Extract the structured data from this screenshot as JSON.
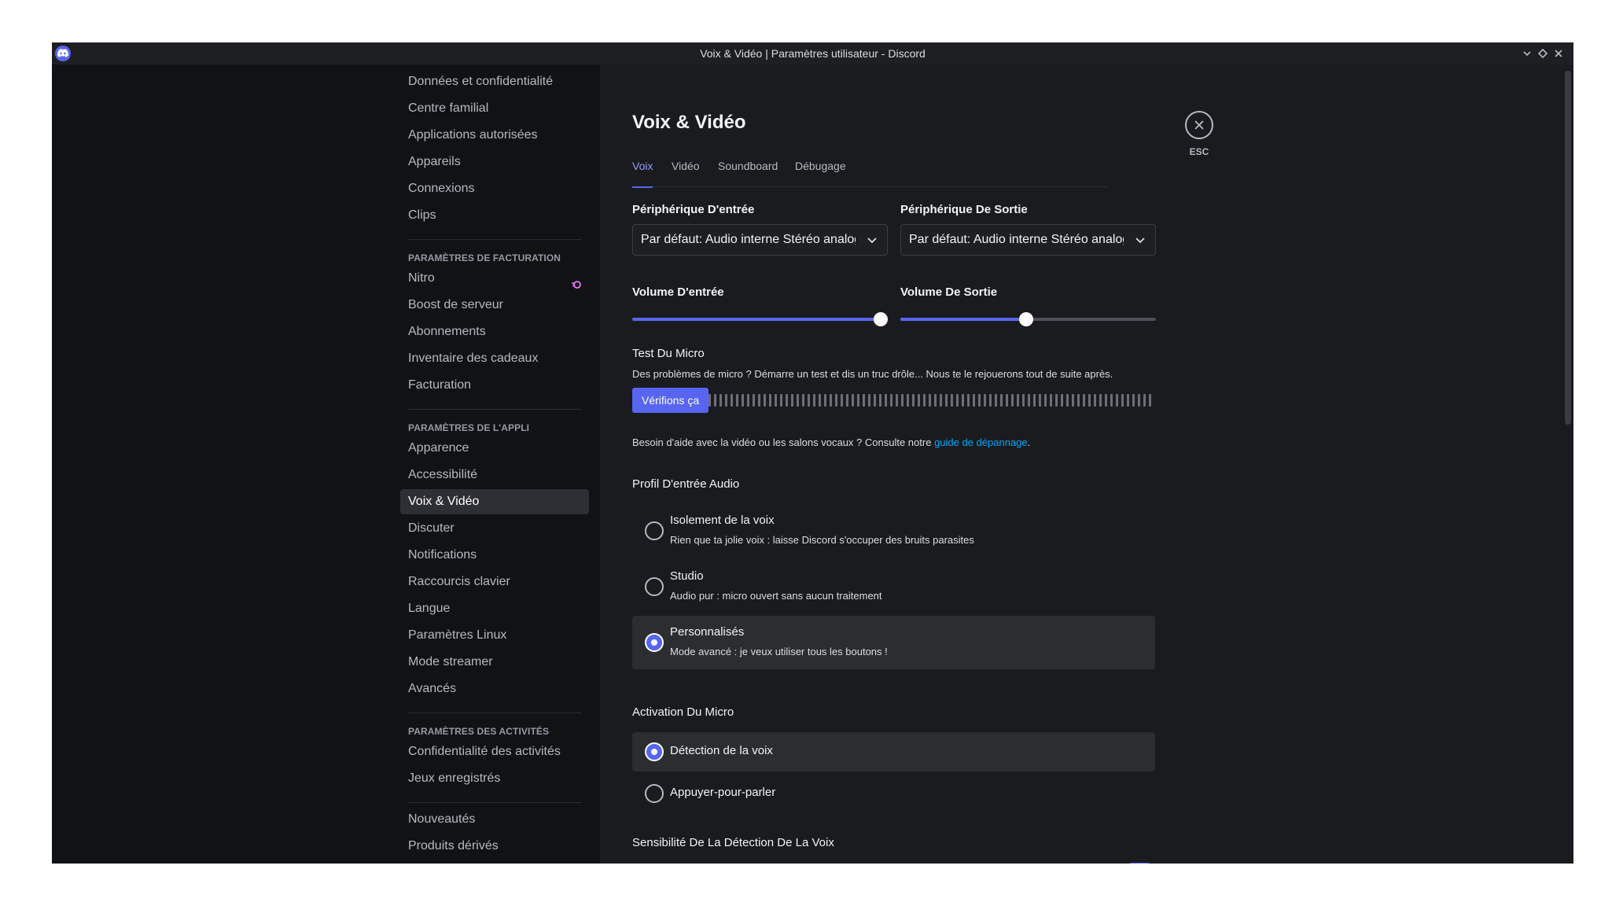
{
  "window": {
    "title": "Voix & Vidéo | Paramètres utilisateur - Discord"
  },
  "sidebar": {
    "items_top": [
      {
        "name": "sidebar-item-donnees-confidentialite",
        "label": "Données et confidentialité"
      },
      {
        "name": "sidebar-item-centre-familial",
        "label": "Centre familial"
      },
      {
        "name": "sidebar-item-applications-autorisees",
        "label": "Applications autorisées"
      },
      {
        "name": "sidebar-item-appareils",
        "label": "Appareils"
      },
      {
        "name": "sidebar-item-connexions",
        "label": "Connexions"
      },
      {
        "name": "sidebar-item-clips",
        "label": "Clips"
      }
    ],
    "billing_header": "PARAMÈTRES DE FACTURATION",
    "billing_items": [
      {
        "name": "sidebar-item-nitro",
        "label": "Nitro"
      },
      {
        "name": "sidebar-item-boost-serveur",
        "label": "Boost de serveur"
      },
      {
        "name": "sidebar-item-abonnements",
        "label": "Abonnements"
      },
      {
        "name": "sidebar-item-inventaire-cadeaux",
        "label": "Inventaire des cadeaux"
      },
      {
        "name": "sidebar-item-facturation",
        "label": "Facturation"
      }
    ],
    "app_header": "PARAMÈTRES DE L'APPLI",
    "app_items": [
      {
        "name": "sidebar-item-apparence",
        "label": "Apparence"
      },
      {
        "name": "sidebar-item-accessibilite",
        "label": "Accessibilité"
      },
      {
        "name": "sidebar-item-voix-video",
        "label": "Voix & Vidéo"
      },
      {
        "name": "sidebar-item-discuter",
        "label": "Discuter"
      },
      {
        "name": "sidebar-item-notifications",
        "label": "Notifications"
      },
      {
        "name": "sidebar-item-raccourcis-clavier",
        "label": "Raccourcis clavier"
      },
      {
        "name": "sidebar-item-langue",
        "label": "Langue"
      },
      {
        "name": "sidebar-item-parametres-linux",
        "label": "Paramètres Linux"
      },
      {
        "name": "sidebar-item-mode-streamer",
        "label": "Mode streamer"
      },
      {
        "name": "sidebar-item-avances",
        "label": "Avancés"
      }
    ],
    "activity_header": "PARAMÈTRES DES ACTIVITÉS",
    "activity_items": [
      {
        "name": "sidebar-item-confidentialite-activites",
        "label": "Confidentialité des activités"
      },
      {
        "name": "sidebar-item-jeux-enregistres",
        "label": "Jeux enregistrés"
      }
    ],
    "bottom_items": [
      {
        "name": "sidebar-item-nouveautes",
        "label": "Nouveautés"
      },
      {
        "name": "sidebar-item-produits-derives",
        "label": "Produits dérivés"
      }
    ],
    "active_item": "Voix & Vidéo"
  },
  "main": {
    "title": "Voix & Vidéo",
    "tabs": [
      "Voix",
      "Vidéo",
      "Soundboard",
      "Débugage"
    ],
    "active_tab": "Voix",
    "close_label": "ESC",
    "input_device": {
      "label": "Périphérique D'entrée",
      "value": "Par défaut: Audio interne Stéréo analogique"
    },
    "output_device": {
      "label": "Périphérique De Sortie",
      "value": "Par défaut: Audio interne Stéréo analogique"
    },
    "input_volume": {
      "label": "Volume D'entrée",
      "percent": 100
    },
    "output_volume": {
      "label": "Volume De Sortie",
      "percent": 50
    },
    "mic_test": {
      "label": "Test Du Micro",
      "description": "Des problèmes de micro ? Démarre un test et dis un truc drôle... Nous te le rejouerons tout de suite après.",
      "button": "Vérifions ça"
    },
    "help": {
      "prefix": "Besoin d'aide avec la vidéo ou les salons vocaux ? Consulte notre ",
      "link": "guide de dépannage",
      "suffix": "."
    },
    "audio_profile": {
      "label": "Profil D'entrée Audio",
      "options": [
        {
          "title": "Isolement de la voix",
          "desc": "Rien que ta jolie voix : laisse Discord s'occuper des bruits parasites"
        },
        {
          "title": "Studio",
          "desc": "Audio pur : micro ouvert sans aucun traitement"
        },
        {
          "title": "Personnalisés",
          "desc": "Mode avancé : je veux utiliser tous les boutons !"
        }
      ],
      "selected": "Personnalisés"
    },
    "mic_activation": {
      "label": "Activation Du Micro",
      "options": [
        "Détection de la voix",
        "Appuyer-pour-parler"
      ],
      "selected": "Détection de la voix"
    },
    "sensitivity": {
      "label": "Sensibilité De La Détection De La Voix"
    }
  },
  "colors": {
    "accent": "#5865f2",
    "link": "#00a8fc",
    "sidebar_bg": "#111214",
    "content_bg": "#1a1b1e"
  }
}
